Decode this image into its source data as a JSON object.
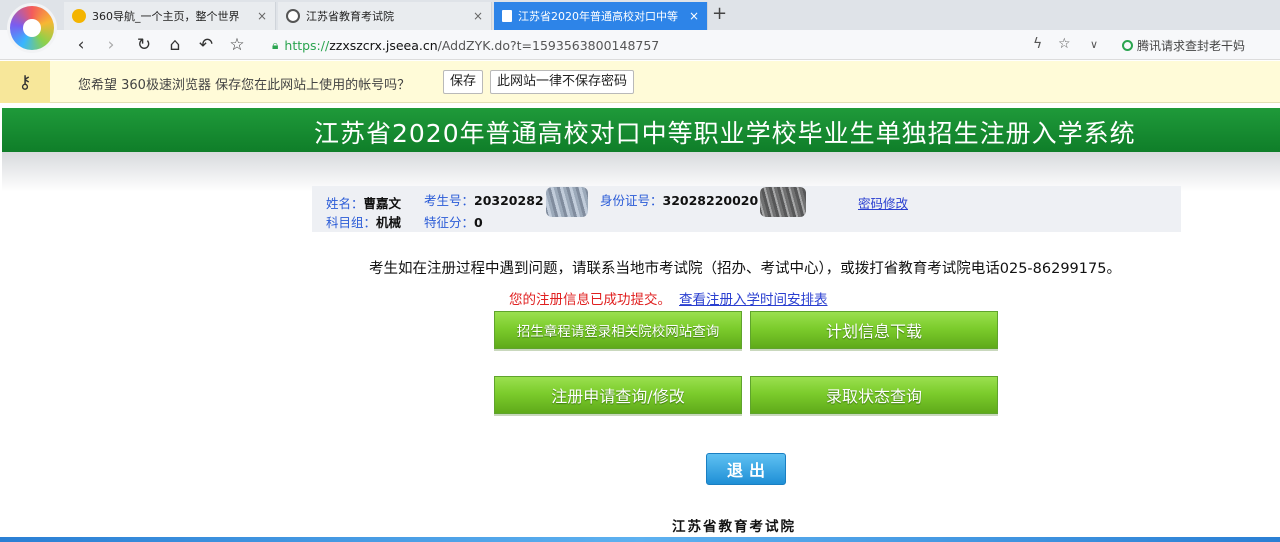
{
  "browser": {
    "tabs": [
      {
        "title": "360导航_一个主页，整个世界",
        "icon": "360-nav-icon",
        "color": "#f4b400"
      },
      {
        "title": "江苏省教育考试院",
        "icon": "jseea-icon",
        "color": "#555555"
      },
      {
        "title": "江苏省2020年普通高校对口中等",
        "icon": "page-icon",
        "color": "#ffffff"
      }
    ],
    "close_glyph": "×",
    "new_tab_glyph": "+",
    "url": {
      "scheme": "https://",
      "host": "zzxszcrx.jseea.cn",
      "path": "/AddZYK.do?t=1593563800148757"
    },
    "search_hint": "腾讯请求查封老干妈"
  },
  "password_bar": {
    "message": "您希望 360极速浏览器 保存您在此网站上使用的帐号吗？",
    "save_label": "保存",
    "never_label": "此网站一律不保存密码"
  },
  "header": {
    "title": "江苏省2020年普通高校对口中等职业学校毕业生单独招生注册入学系统"
  },
  "info": {
    "name_label": "姓名：",
    "name_value": "曹嘉文",
    "exam_no_label": "考生号：",
    "exam_no_value": "20320282",
    "id_label": "身份证号：",
    "id_value": "32028220020",
    "change_pw_link": "密码修改",
    "subject_label": "科目组：",
    "subject_value": "机械",
    "bonus_label": "特征分：",
    "bonus_value": "0"
  },
  "main": {
    "notice": "考生如在注册过程中遇到问题，请联系当地市考试院（招办、考试中心），或拨打省教育考试院电话025-86299175。",
    "status_ok": "您的注册信息已成功提交。",
    "schedule_link": "查看注册入学时间安排表",
    "buttons": {
      "admission_rules": "招生章程请登录相关院校网站查询",
      "plan_download": "计划信息下载",
      "registration_query": "注册申请查询/修改",
      "admission_status": "录取状态查询"
    },
    "logout": "退出",
    "footer_org": "江苏省教育考试院"
  },
  "colors": {
    "header_green": "#1f9a3a",
    "button_green": "#7ccc2c",
    "logout_blue": "#1f8fd6",
    "tab_active": "#2d84e8",
    "success_red": "#e02020",
    "link_blue": "#2a3fd0"
  }
}
